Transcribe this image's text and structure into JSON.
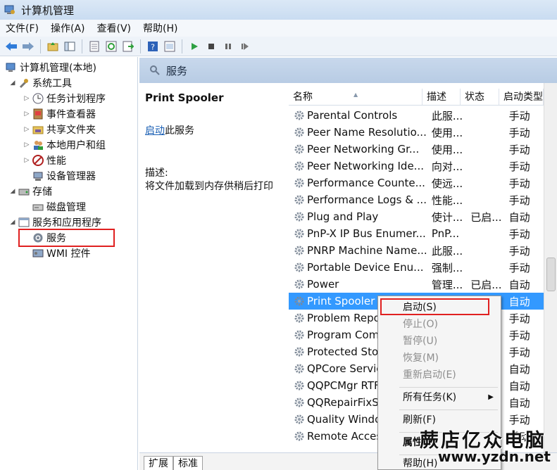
{
  "window": {
    "title": "计算机管理"
  },
  "menu": [
    "文件(F)",
    "操作(A)",
    "查看(V)",
    "帮助(H)"
  ],
  "tree": {
    "items": [
      {
        "label": "计算机管理(本地)",
        "icon": "computer-manage-icon"
      },
      {
        "label": "系统工具",
        "icon": "tools-icon"
      },
      {
        "label": "任务计划程序",
        "icon": "clock-icon"
      },
      {
        "label": "事件查看器",
        "icon": "event-viewer-icon"
      },
      {
        "label": "共享文件夹",
        "icon": "shared-folder-icon"
      },
      {
        "label": "本地用户和组",
        "icon": "users-icon"
      },
      {
        "label": "性能",
        "icon": "performance-icon"
      },
      {
        "label": "设备管理器",
        "icon": "device-manager-icon"
      },
      {
        "label": "存储",
        "icon": "storage-icon"
      },
      {
        "label": "磁盘管理",
        "icon": "disk-icon"
      },
      {
        "label": "服务和应用程序",
        "icon": "services-apps-icon"
      },
      {
        "label": "服务",
        "icon": "services-icon"
      },
      {
        "label": "WMI 控件",
        "icon": "wmi-icon"
      }
    ]
  },
  "services_header": {
    "title": "服务"
  },
  "details": {
    "name": "Print Spooler",
    "start_link": "启动",
    "start_suffix": "此服务",
    "desc_label": "描述:",
    "desc_text": "将文件加载到内存供稍后打印"
  },
  "list": {
    "columns": [
      "名称",
      "描述",
      "状态",
      "启动类型"
    ],
    "rows": [
      {
        "name": "Parental Controls",
        "desc": "此服...",
        "status": "",
        "start": "手动"
      },
      {
        "name": "Peer Name Resolutio...",
        "desc": "使用...",
        "status": "",
        "start": "手动"
      },
      {
        "name": "Peer Networking Gr...",
        "desc": "使用...",
        "status": "",
        "start": "手动"
      },
      {
        "name": "Peer Networking Ide...",
        "desc": "向对...",
        "status": "",
        "start": "手动"
      },
      {
        "name": "Performance Counte...",
        "desc": "使远...",
        "status": "",
        "start": "手动"
      },
      {
        "name": "Performance Logs & ...",
        "desc": "性能...",
        "status": "",
        "start": "手动"
      },
      {
        "name": "Plug and Play",
        "desc": "使计...",
        "status": "已启...",
        "start": "自动"
      },
      {
        "name": "PnP-X IP Bus Enumer...",
        "desc": "PnP...",
        "status": "",
        "start": "手动"
      },
      {
        "name": "PNRP Machine Name...",
        "desc": "此服...",
        "status": "",
        "start": "手动"
      },
      {
        "name": "Portable Device Enu...",
        "desc": "强制...",
        "status": "",
        "start": "手动"
      },
      {
        "name": "Power",
        "desc": "管理...",
        "status": "已启...",
        "start": "自动"
      },
      {
        "name": "Print Spooler",
        "desc": "",
        "status": "",
        "start": "自动"
      },
      {
        "name": "Problem Repo",
        "desc": "",
        "status": "",
        "start": "手动"
      },
      {
        "name": "Program Com",
        "desc": "",
        "status": "",
        "start": "手动"
      },
      {
        "name": "Protected Sto",
        "desc": "",
        "status": "",
        "start": "手动"
      },
      {
        "name": "QPCore Servic",
        "desc": "",
        "status": "",
        "start": "自动"
      },
      {
        "name": "QQPCMgr RTF",
        "desc": "",
        "status": "",
        "start": "自动"
      },
      {
        "name": "QQRepairFixS",
        "desc": "",
        "status": "",
        "start": "自动"
      },
      {
        "name": "Quality Windo",
        "desc": "",
        "status": "",
        "start": "手动"
      },
      {
        "name": "Remote Acces",
        "desc": "",
        "status": "",
        "start": "手动"
      }
    ]
  },
  "context_menu": {
    "items": [
      "启动(S)",
      "停止(O)",
      "暂停(U)",
      "恢复(M)",
      "重新启动(E)",
      "所有任务(K)",
      "刷新(F)",
      "属性",
      "帮助(H)"
    ]
  },
  "tabs": [
    "扩展",
    "标准"
  ],
  "watermark": {
    "text": "蕨店亿众电脑",
    "url": "www.yzdn.net"
  },
  "colors": {
    "selection": "#3399ff",
    "highlight_box": "#e02020",
    "header_bg": "#c8d8ec"
  }
}
